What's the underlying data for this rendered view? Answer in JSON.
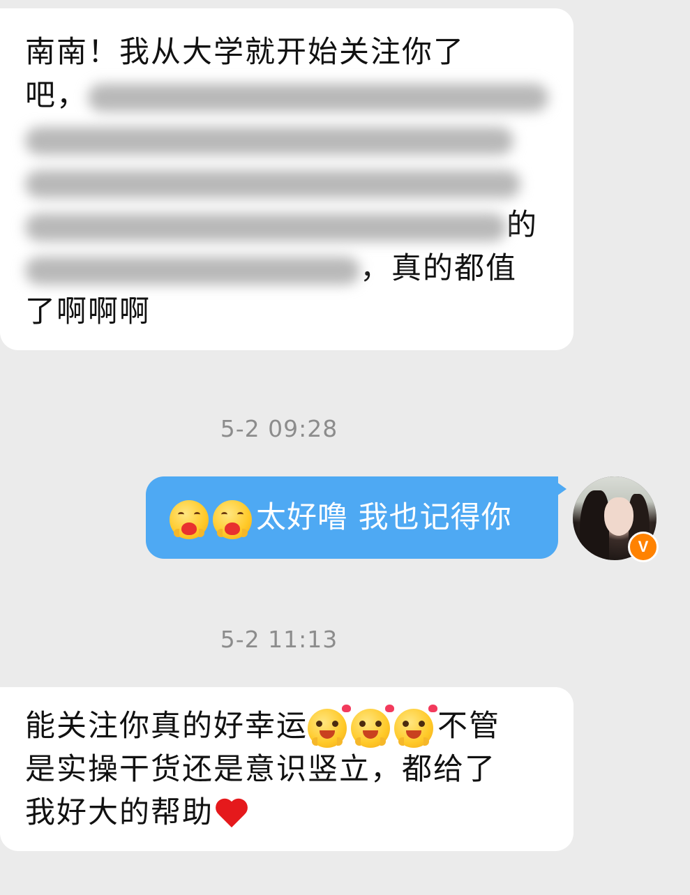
{
  "messages": {
    "first": {
      "line1": "南南！我从大学就开始关注你了",
      "line2_start": "吧，",
      "line5_end": "的",
      "line6_end": "，真的都值",
      "line7": "了啊啊啊"
    },
    "timestamp1": "5-2 09:28",
    "reply": {
      "text": "太好噜 我也记得你",
      "emoji_name": "hugging-face-emoji"
    },
    "timestamp2": "5-2 11:13",
    "second": {
      "line1_start": "能关注你真的好幸运",
      "line1_end": "不管",
      "line2": "是实操干货还是意识竖立，都给了",
      "line3": "我好大的帮助",
      "emoji_name": "smiling-hearts-emoji"
    }
  },
  "avatar": {
    "badge_label": "V",
    "badge_color": "#ff8200"
  },
  "colors": {
    "background": "#ebebeb",
    "incoming_bubble": "#ffffff",
    "outgoing_bubble": "#4ea9f3",
    "timestamp_text": "#8c8c8c"
  }
}
